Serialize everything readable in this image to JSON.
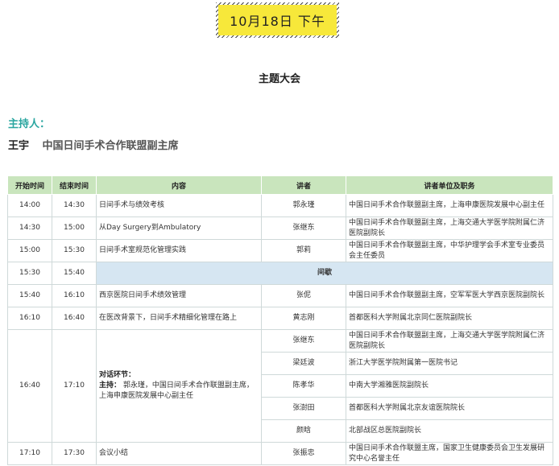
{
  "date_banner": "10月18日 下午",
  "session_title": "主题大会",
  "host": {
    "label": "主持人：",
    "name": "王宇",
    "title": "中国日间手术合作联盟副主席"
  },
  "table": {
    "headers": [
      "开始时间",
      "结束时间",
      "内容",
      "讲者",
      "讲者单位及职务"
    ],
    "rows": [
      {
        "start": "14:00",
        "end": "14:30",
        "content": "日间手术与绩效考核",
        "speaker": "郭永瑾",
        "org": "中国日间手术合作联盟副主席，上海申康医院发展中心副主任"
      },
      {
        "start": "14:30",
        "end": "15:00",
        "content": "从Day Surgery到Ambulatory",
        "speaker": "张继东",
        "org": "中国日间手术合作联盟副主席，上海交通大学医学院附属仁济医院副院长"
      },
      {
        "start": "15:00",
        "end": "15:30",
        "content": "日间手术室规范化管理实践",
        "speaker": "郭莉",
        "org": "中国日间手术合作联盟副主席，中华护理学会手术室专业委员会主任委员"
      },
      {
        "start": "15:30",
        "end": "15:40",
        "break": "间歇"
      },
      {
        "start": "15:40",
        "end": "16:10",
        "content": "西京医院日间手术绩效管理",
        "speaker": "张伲",
        "org": "中国日间手术合作联盟副主席，空军军医大学西京医院副院长"
      },
      {
        "start": "16:10",
        "end": "16:40",
        "content": "在医改背景下，日间手术精细化管理在路上",
        "speaker": "黄志刚",
        "org": "首都医科大学附属北京同仁医院副院长"
      }
    ],
    "discussion": {
      "start": "16:40",
      "end": "17:10",
      "title": "对话环节：",
      "host_label": "主持：",
      "host_text": "郭永瑾，中国日间手术合作联盟副主席，上海申康医院发展中心副主任",
      "panel": [
        {
          "speaker": "张继东",
          "org": "中国日间手术合作联盟副主席，上海交通大学医学院附属仁济医院副院长"
        },
        {
          "speaker": "梁廷波",
          "org": "浙江大学医学院附属第一医院书记"
        },
        {
          "speaker": "陈孝华",
          "org": "中南大学湘雅医院副院长"
        },
        {
          "speaker": "张澍田",
          "org": "首都医科大学附属北京友谊医院院长"
        },
        {
          "speaker": "颜晗",
          "org": "北部战区总医院副院长"
        }
      ]
    },
    "final": {
      "start": "17:10",
      "end": "17:30",
      "content": "会议小结",
      "speaker": "张振忠",
      "org": "中国日间手术合作联盟主席，国家卫生健康委员会卫生发展研究中心名誉主任"
    }
  }
}
